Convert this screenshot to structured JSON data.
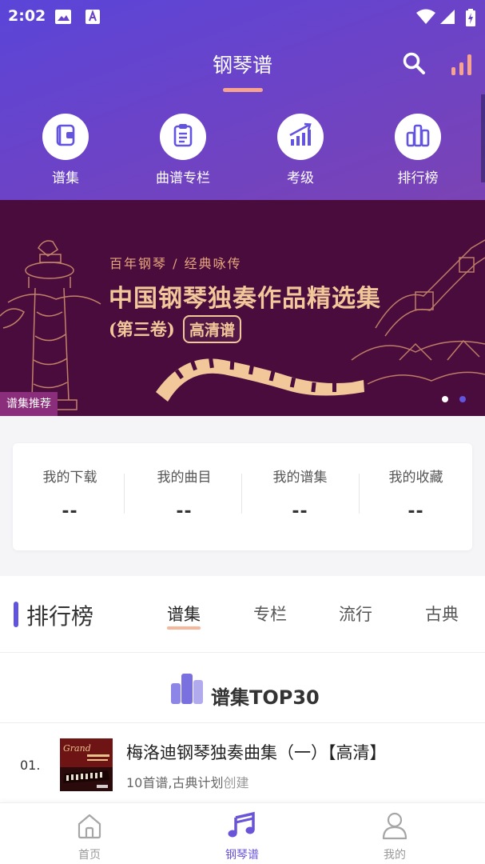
{
  "status_bar": {
    "time": "2:02"
  },
  "header": {
    "title": "钢琴谱",
    "icons": [
      "search-icon",
      "bar-chart-icon"
    ],
    "accent_color": "#f6a38f"
  },
  "quick_nav": [
    {
      "label": "谱集",
      "icon": "notebook-icon"
    },
    {
      "label": "曲谱专栏",
      "icon": "clipboard-icon"
    },
    {
      "label": "考级",
      "icon": "rising-bars-icon"
    },
    {
      "label": "排行榜",
      "icon": "ranking-bars-icon"
    }
  ],
  "banner": {
    "subtitle": "百年钢琴 / 经典咏传",
    "title": "中国钢琴独奏作品精选集",
    "volume": "(第三卷)",
    "hd_badge": "高清谱",
    "tag": "谱集推荐",
    "active_slide": 2,
    "slide_count": 2
  },
  "my_stats": [
    {
      "label": "我的下载",
      "value": "--"
    },
    {
      "label": "我的曲目",
      "value": "--"
    },
    {
      "label": "我的谱集",
      "value": "--"
    },
    {
      "label": "我的收藏",
      "value": "--"
    }
  ],
  "rank": {
    "title": "排行榜",
    "tabs": [
      "谱集",
      "专栏",
      "流行",
      "古典"
    ],
    "active_tab": "谱集",
    "list_title": "谱集TOP30",
    "items": [
      {
        "rank": "01.",
        "name": "梅洛迪钢琴独奏曲集（一）【高清】",
        "meta": "10首谱,古典计划",
        "meta_suffix": "创建"
      }
    ]
  },
  "bottom_nav": [
    {
      "label": "首页",
      "icon": "home-icon",
      "active": false
    },
    {
      "label": "钢琴谱",
      "icon": "music-note-icon",
      "active": true
    },
    {
      "label": "我的",
      "icon": "user-icon",
      "active": false
    }
  ],
  "colors": {
    "header_gradient_start": "#5a45d8",
    "header_gradient_end": "#7b43b4",
    "primary": "#6253e0",
    "banner_bg": "#4a0c3d",
    "banner_gold": "#f2c79a"
  }
}
